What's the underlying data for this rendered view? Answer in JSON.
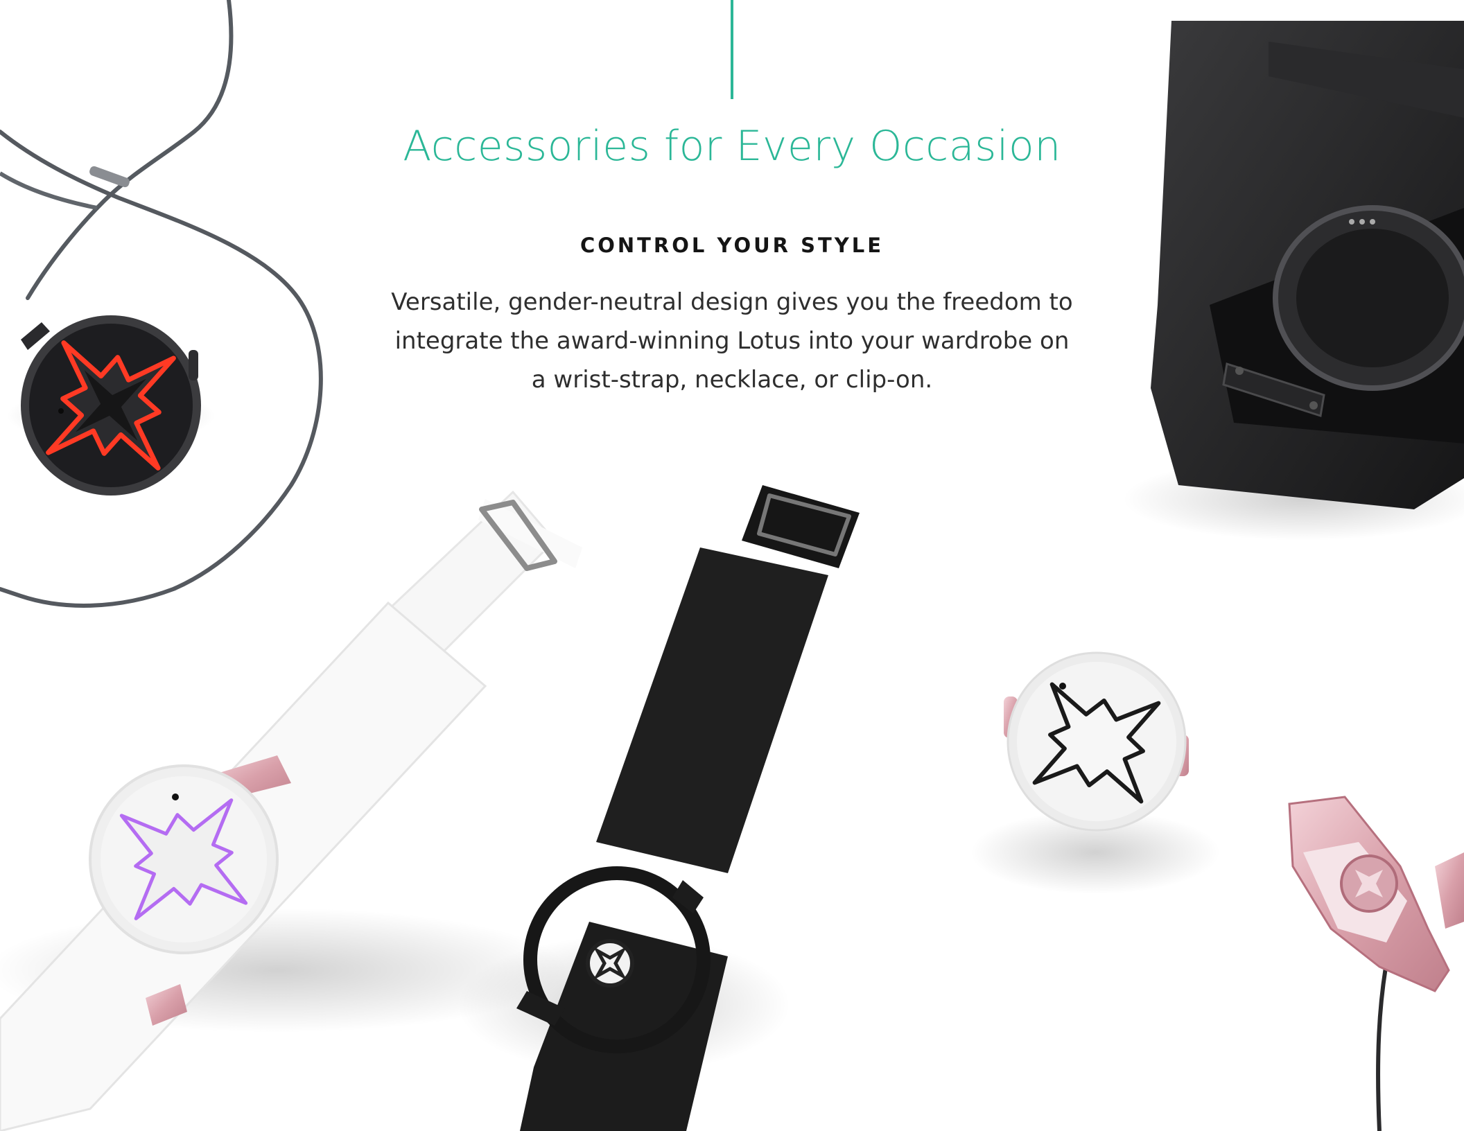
{
  "heading": {
    "title": "Accessories for Every Occasion",
    "eyebrow": "CONTROL YOUR STYLE",
    "body": "Versatile, gender-neutral design gives you the freedom to integrate the award-winning Lotus into your wardrobe on a wrist-strap, necklace, or clip-on."
  },
  "colors": {
    "accent": "#2bb797",
    "background": "#ffffff",
    "text": "#2e2e2e"
  },
  "products": [
    {
      "icon": "necklace-pendant-red-icon"
    },
    {
      "icon": "charging-dock-icon"
    },
    {
      "icon": "white-wrist-strap-purple-device-icon"
    },
    {
      "icon": "black-wrist-strap-frame-icon"
    },
    {
      "icon": "white-clip-on-device-icon"
    },
    {
      "icon": "rose-gold-clip-frame-icon"
    }
  ]
}
